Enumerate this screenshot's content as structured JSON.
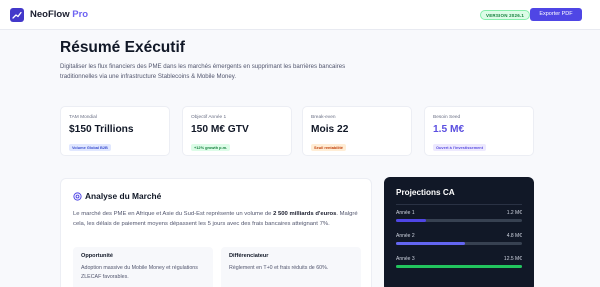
{
  "header": {
    "brand_name": "NeoFlow",
    "brand_suffix": "Pro",
    "version_badge": "VERSION 2026.1",
    "export_label": "Exporter PDF"
  },
  "hero": {
    "title": "Résumé Exécutif",
    "subtitle": "Digitaliser les flux financiers des PME dans les marchés émergents en supprimant les barrières bancaires traditionnelles via une infrastructure Stablecoins & Mobile Money."
  },
  "kpis": [
    {
      "label": "TAM Mondial",
      "value": "$150 Trillions",
      "badge": "Volume Global B2B"
    },
    {
      "label": "Objectif Année 1",
      "value": "150 M€ GTV",
      "badge": "+12% growth p.m."
    },
    {
      "label": "Break-even",
      "value": "Mois 22",
      "badge": "Seuil rentabilité"
    },
    {
      "label": "Besoin Seed",
      "value": "1.5 M€",
      "badge": "Ouvert à l'investissement"
    }
  ],
  "analysis": {
    "title": "Analyse du Marché",
    "text_before": "Le marché des PME en Afrique et Asie du Sud-Est représente un volume de ",
    "text_bold": "2 500 milliards d'euros",
    "text_after": ". Malgré cela, les délais de paiement moyens dépassent les 5 jours avec des frais bancaires atteignant 7%.",
    "cards": [
      {
        "title": "Opportunité",
        "text": "Adoption massive du Mobile Money et régulations ZLECAF favorables."
      },
      {
        "title": "Différenciateur",
        "text": "Règlement en T+0 et frais réduits de 60%."
      }
    ]
  },
  "projections": {
    "title": "Projections CA",
    "rows": [
      {
        "year": "Année 1",
        "value": "1.2 M€",
        "fraction": 0.24,
        "color": "#4f46e5"
      },
      {
        "year": "Année 2",
        "value": "4.8 M€",
        "fraction": 0.55,
        "color": "#6366f1"
      },
      {
        "year": "Année 3",
        "value": "12.5 M€",
        "fraction": 1.0,
        "color": "#22c55e"
      }
    ]
  }
}
